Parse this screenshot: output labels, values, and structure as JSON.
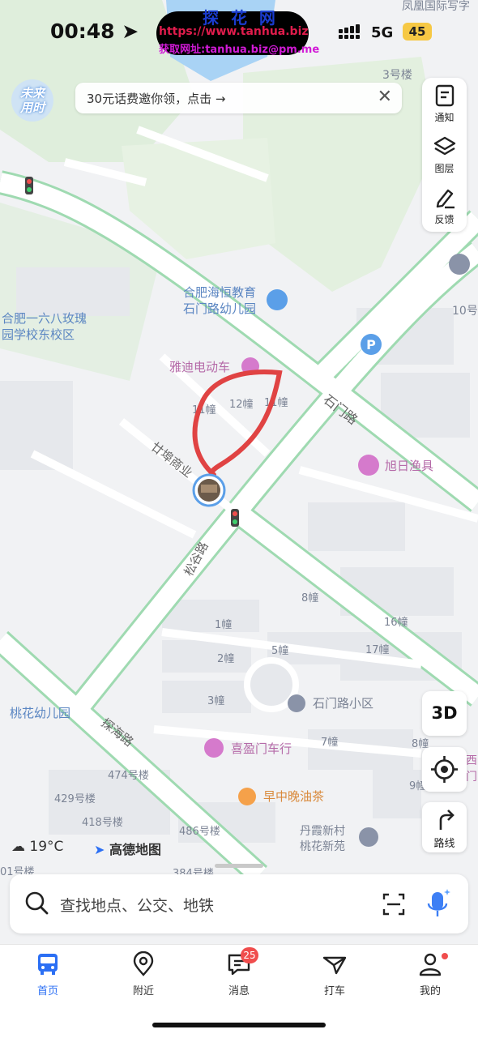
{
  "status_bar": {
    "time": "00:48",
    "network": "5G",
    "battery": "45"
  },
  "watermark": {
    "title": "探 花 网",
    "url": "https://www.tanhua.biz",
    "contact": "获取网址:tanhua.biz@pm.me"
  },
  "logo": {
    "line1": "未来",
    "line2": "用时"
  },
  "banner": {
    "text": "30元话费邀你领，点击 →",
    "close": "✕"
  },
  "tools": [
    {
      "label": "通知",
      "icon": "notice-icon"
    },
    {
      "label": "图层",
      "icon": "layers-icon"
    },
    {
      "label": "反馈",
      "icon": "feedback-icon"
    }
  ],
  "float_buttons": {
    "three_d": "3D",
    "route": "路线"
  },
  "map": {
    "labels": {
      "fenghuang": "凤凰国际写字",
      "bldg3": "3号楼",
      "bldg10": "10号",
      "school_hh": "合肥海恒教育",
      "school_sm": "石门路幼儿园",
      "school168_1": "合肥一六八玫瑰",
      "school168_2": "园学校东校区",
      "yadi": "雅迪电动车",
      "b11a": "11幢",
      "b12": "12幢",
      "b11b": "11幢",
      "shimen_road": "石门路",
      "xuri": "旭日渔具",
      "niangfu": "廿埠商业",
      "songgu": "松谷路",
      "b8": "8幢",
      "b16": "16幢",
      "b1": "1幢",
      "b5": "5幢",
      "b17": "17幢",
      "b2": "2幢",
      "b3": "3幢",
      "shimen_xq": "石门路小区",
      "b7": "7幢",
      "b8r": "8幢",
      "b9": "9幢",
      "taohua_kg": "桃花幼儿园",
      "tanhai": "探海路",
      "xiying": "喜盈门车行",
      "zaozhong": "早中晚油茶",
      "b474": "474号楼",
      "b429": "429号楼",
      "b418": "418号楼",
      "b486": "486号楼",
      "danxia1": "丹霞新村",
      "danxia2": "桃花新苑",
      "xiya1": "西",
      "xiya2": "门",
      "b401": "01号楼",
      "b384": "384号楼"
    },
    "weather": "19°C",
    "map_brand": "高德地图"
  },
  "search": {
    "placeholder": "查找地点、公交、地铁"
  },
  "tabs": [
    {
      "label": "首页",
      "icon": "bus-icon",
      "active": true
    },
    {
      "label": "附近",
      "icon": "location-pin-icon"
    },
    {
      "label": "消息",
      "icon": "message-icon",
      "badge": "25"
    },
    {
      "label": "打车",
      "icon": "taxi-icon"
    },
    {
      "label": "我的",
      "icon": "profile-icon"
    }
  ]
}
